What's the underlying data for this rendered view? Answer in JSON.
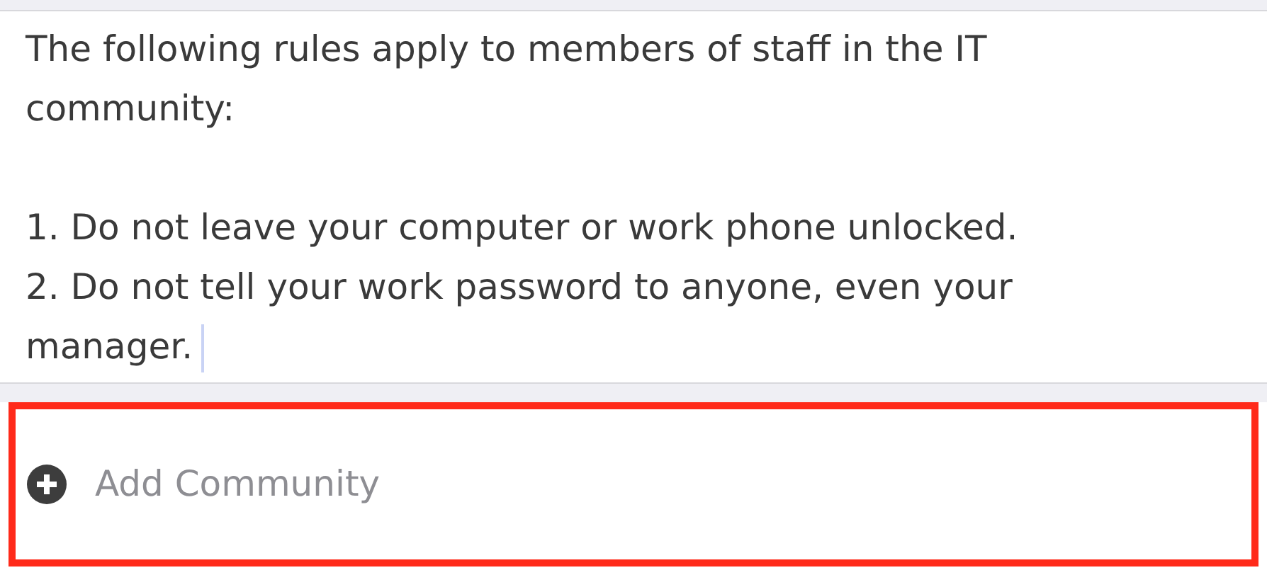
{
  "rules_text": {
    "paragraphs": [
      "The following rules apply to members of staff in the IT community:",
      "1. Do not leave your computer or work phone unlocked.\n2. Do not tell your work password to anyone, even your manager."
    ],
    "cursor": true
  },
  "add_row": {
    "label": "Add Community",
    "highlighted": true
  }
}
